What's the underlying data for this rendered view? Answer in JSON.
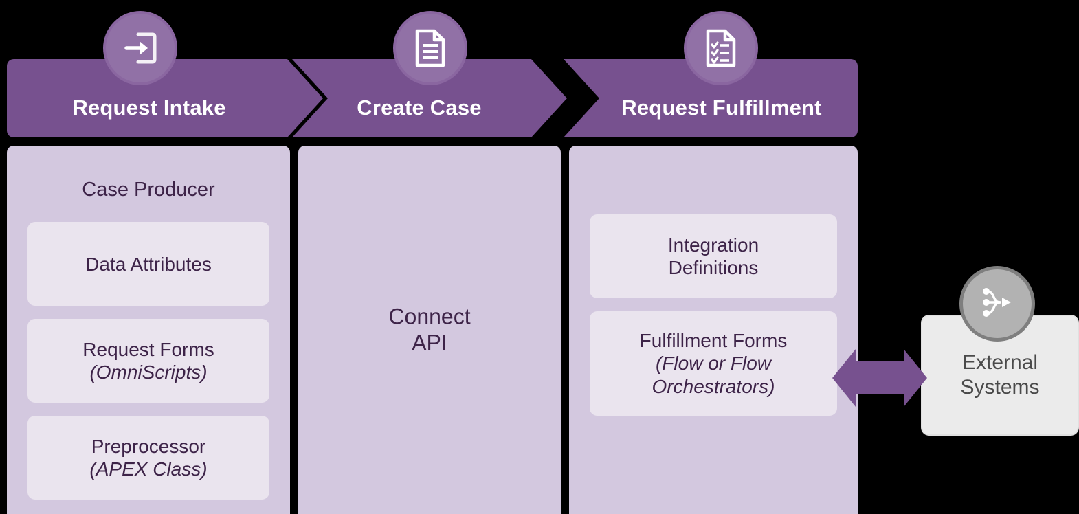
{
  "colors": {
    "chevron_purple": "#77518f",
    "badge_purple": "#9171a6",
    "column_body": "#d3c8df",
    "card_bg": "#eae4ee",
    "text_purple": "#3d2348",
    "external_box_bg": "#ebebeb",
    "external_badge_gray": "#b2b2b2",
    "background": "#000000"
  },
  "stages": [
    {
      "id": "request-intake",
      "title": "Request Intake",
      "icon": "login-arrow-icon",
      "heading": "Case Producer",
      "cards": [
        {
          "title": "Data Attributes",
          "sub": ""
        },
        {
          "title": "Request Forms",
          "sub": "(OmniScripts)"
        },
        {
          "title": "Preprocessor",
          "sub": "(APEX Class)"
        }
      ]
    },
    {
      "id": "create-case",
      "title": "Create Case",
      "icon": "document-icon",
      "center_line1": "Connect",
      "center_line2": "API"
    },
    {
      "id": "request-fulfillment",
      "title": "Request Fulfillment",
      "icon": "checklist-document-icon",
      "cards": [
        {
          "title": "Integration",
          "sub2": "Definitions"
        },
        {
          "title": "Fulfillment Forms",
          "sub": "(Flow or Flow",
          "sub_b": "Orchestrators)"
        }
      ]
    }
  ],
  "external": {
    "icon": "integration-branch-icon",
    "line1": "External",
    "line2": "Systems",
    "connector": "double-headed-arrow"
  }
}
